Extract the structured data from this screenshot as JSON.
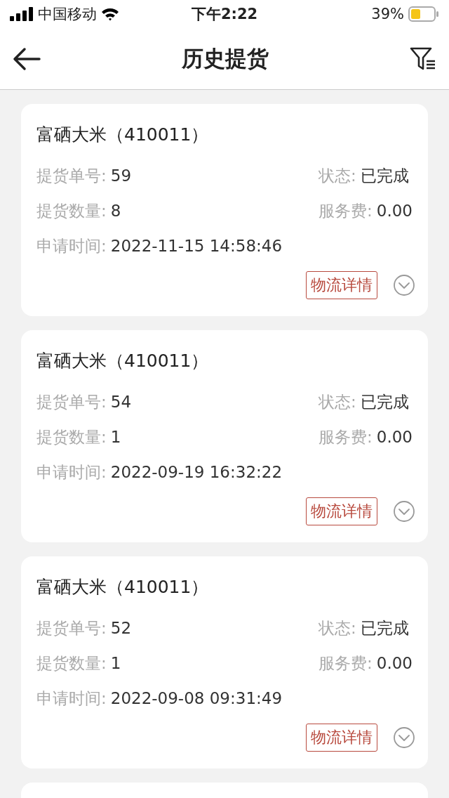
{
  "status_bar": {
    "carrier": "中国移动",
    "time": "下午2:22",
    "battery": "39%"
  },
  "nav": {
    "title": "历史提货"
  },
  "orders": [
    {
      "product": "富硒大米（410011）",
      "fields": [
        {
          "label": "提货单号:",
          "value": "59"
        },
        {
          "label": "状态:",
          "value": "已完成"
        },
        {
          "label": "提货数量:",
          "value": "8"
        },
        {
          "label": "服务费:",
          "value": "0.00"
        },
        {
          "label": "申请时间:",
          "value": "2022-11-15 14:58:46"
        }
      ],
      "action": "物流详情",
      "expanded": false
    },
    {
      "product": "富硒大米（410011）",
      "fields": [
        {
          "label": "提货单号:",
          "value": "54"
        },
        {
          "label": "状态:",
          "value": "已完成"
        },
        {
          "label": "提货数量:",
          "value": "1"
        },
        {
          "label": "服务费:",
          "value": "0.00"
        },
        {
          "label": "申请时间:",
          "value": "2022-09-19 16:32:22"
        }
      ],
      "action": "物流详情",
      "expanded": false
    },
    {
      "product": "富硒大米（410011）",
      "fields": [
        {
          "label": "提货单号:",
          "value": "52"
        },
        {
          "label": "状态:",
          "value": "已完成"
        },
        {
          "label": "提货数量:",
          "value": "1"
        },
        {
          "label": "服务费:",
          "value": "0.00"
        },
        {
          "label": "申请时间:",
          "value": "2022-09-08 09:31:49"
        }
      ],
      "action": "物流详情",
      "expanded": false
    }
  ]
}
